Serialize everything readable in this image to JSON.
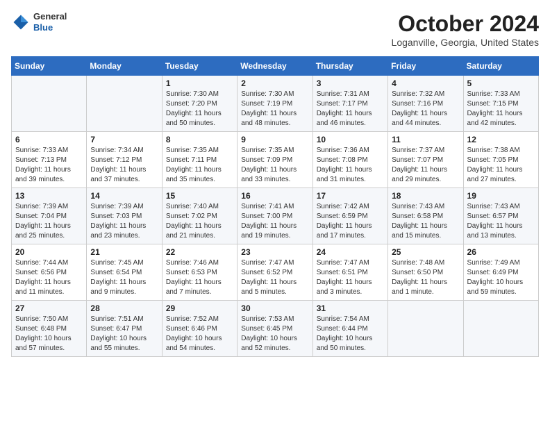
{
  "header": {
    "logo_general": "General",
    "logo_blue": "Blue",
    "month_title": "October 2024",
    "location": "Loganville, Georgia, United States"
  },
  "days_of_week": [
    "Sunday",
    "Monday",
    "Tuesday",
    "Wednesday",
    "Thursday",
    "Friday",
    "Saturday"
  ],
  "weeks": [
    [
      null,
      null,
      {
        "num": "1",
        "sunrise": "Sunrise: 7:30 AM",
        "sunset": "Sunset: 7:20 PM",
        "daylight": "Daylight: 11 hours and 50 minutes."
      },
      {
        "num": "2",
        "sunrise": "Sunrise: 7:30 AM",
        "sunset": "Sunset: 7:19 PM",
        "daylight": "Daylight: 11 hours and 48 minutes."
      },
      {
        "num": "3",
        "sunrise": "Sunrise: 7:31 AM",
        "sunset": "Sunset: 7:17 PM",
        "daylight": "Daylight: 11 hours and 46 minutes."
      },
      {
        "num": "4",
        "sunrise": "Sunrise: 7:32 AM",
        "sunset": "Sunset: 7:16 PM",
        "daylight": "Daylight: 11 hours and 44 minutes."
      },
      {
        "num": "5",
        "sunrise": "Sunrise: 7:33 AM",
        "sunset": "Sunset: 7:15 PM",
        "daylight": "Daylight: 11 hours and 42 minutes."
      }
    ],
    [
      {
        "num": "6",
        "sunrise": "Sunrise: 7:33 AM",
        "sunset": "Sunset: 7:13 PM",
        "daylight": "Daylight: 11 hours and 39 minutes."
      },
      {
        "num": "7",
        "sunrise": "Sunrise: 7:34 AM",
        "sunset": "Sunset: 7:12 PM",
        "daylight": "Daylight: 11 hours and 37 minutes."
      },
      {
        "num": "8",
        "sunrise": "Sunrise: 7:35 AM",
        "sunset": "Sunset: 7:11 PM",
        "daylight": "Daylight: 11 hours and 35 minutes."
      },
      {
        "num": "9",
        "sunrise": "Sunrise: 7:35 AM",
        "sunset": "Sunset: 7:09 PM",
        "daylight": "Daylight: 11 hours and 33 minutes."
      },
      {
        "num": "10",
        "sunrise": "Sunrise: 7:36 AM",
        "sunset": "Sunset: 7:08 PM",
        "daylight": "Daylight: 11 hours and 31 minutes."
      },
      {
        "num": "11",
        "sunrise": "Sunrise: 7:37 AM",
        "sunset": "Sunset: 7:07 PM",
        "daylight": "Daylight: 11 hours and 29 minutes."
      },
      {
        "num": "12",
        "sunrise": "Sunrise: 7:38 AM",
        "sunset": "Sunset: 7:05 PM",
        "daylight": "Daylight: 11 hours and 27 minutes."
      }
    ],
    [
      {
        "num": "13",
        "sunrise": "Sunrise: 7:39 AM",
        "sunset": "Sunset: 7:04 PM",
        "daylight": "Daylight: 11 hours and 25 minutes."
      },
      {
        "num": "14",
        "sunrise": "Sunrise: 7:39 AM",
        "sunset": "Sunset: 7:03 PM",
        "daylight": "Daylight: 11 hours and 23 minutes."
      },
      {
        "num": "15",
        "sunrise": "Sunrise: 7:40 AM",
        "sunset": "Sunset: 7:02 PM",
        "daylight": "Daylight: 11 hours and 21 minutes."
      },
      {
        "num": "16",
        "sunrise": "Sunrise: 7:41 AM",
        "sunset": "Sunset: 7:00 PM",
        "daylight": "Daylight: 11 hours and 19 minutes."
      },
      {
        "num": "17",
        "sunrise": "Sunrise: 7:42 AM",
        "sunset": "Sunset: 6:59 PM",
        "daylight": "Daylight: 11 hours and 17 minutes."
      },
      {
        "num": "18",
        "sunrise": "Sunrise: 7:43 AM",
        "sunset": "Sunset: 6:58 PM",
        "daylight": "Daylight: 11 hours and 15 minutes."
      },
      {
        "num": "19",
        "sunrise": "Sunrise: 7:43 AM",
        "sunset": "Sunset: 6:57 PM",
        "daylight": "Daylight: 11 hours and 13 minutes."
      }
    ],
    [
      {
        "num": "20",
        "sunrise": "Sunrise: 7:44 AM",
        "sunset": "Sunset: 6:56 PM",
        "daylight": "Daylight: 11 hours and 11 minutes."
      },
      {
        "num": "21",
        "sunrise": "Sunrise: 7:45 AM",
        "sunset": "Sunset: 6:54 PM",
        "daylight": "Daylight: 11 hours and 9 minutes."
      },
      {
        "num": "22",
        "sunrise": "Sunrise: 7:46 AM",
        "sunset": "Sunset: 6:53 PM",
        "daylight": "Daylight: 11 hours and 7 minutes."
      },
      {
        "num": "23",
        "sunrise": "Sunrise: 7:47 AM",
        "sunset": "Sunset: 6:52 PM",
        "daylight": "Daylight: 11 hours and 5 minutes."
      },
      {
        "num": "24",
        "sunrise": "Sunrise: 7:47 AM",
        "sunset": "Sunset: 6:51 PM",
        "daylight": "Daylight: 11 hours and 3 minutes."
      },
      {
        "num": "25",
        "sunrise": "Sunrise: 7:48 AM",
        "sunset": "Sunset: 6:50 PM",
        "daylight": "Daylight: 11 hours and 1 minute."
      },
      {
        "num": "26",
        "sunrise": "Sunrise: 7:49 AM",
        "sunset": "Sunset: 6:49 PM",
        "daylight": "Daylight: 10 hours and 59 minutes."
      }
    ],
    [
      {
        "num": "27",
        "sunrise": "Sunrise: 7:50 AM",
        "sunset": "Sunset: 6:48 PM",
        "daylight": "Daylight: 10 hours and 57 minutes."
      },
      {
        "num": "28",
        "sunrise": "Sunrise: 7:51 AM",
        "sunset": "Sunset: 6:47 PM",
        "daylight": "Daylight: 10 hours and 55 minutes."
      },
      {
        "num": "29",
        "sunrise": "Sunrise: 7:52 AM",
        "sunset": "Sunset: 6:46 PM",
        "daylight": "Daylight: 10 hours and 54 minutes."
      },
      {
        "num": "30",
        "sunrise": "Sunrise: 7:53 AM",
        "sunset": "Sunset: 6:45 PM",
        "daylight": "Daylight: 10 hours and 52 minutes."
      },
      {
        "num": "31",
        "sunrise": "Sunrise: 7:54 AM",
        "sunset": "Sunset: 6:44 PM",
        "daylight": "Daylight: 10 hours and 50 minutes."
      },
      null,
      null
    ]
  ]
}
